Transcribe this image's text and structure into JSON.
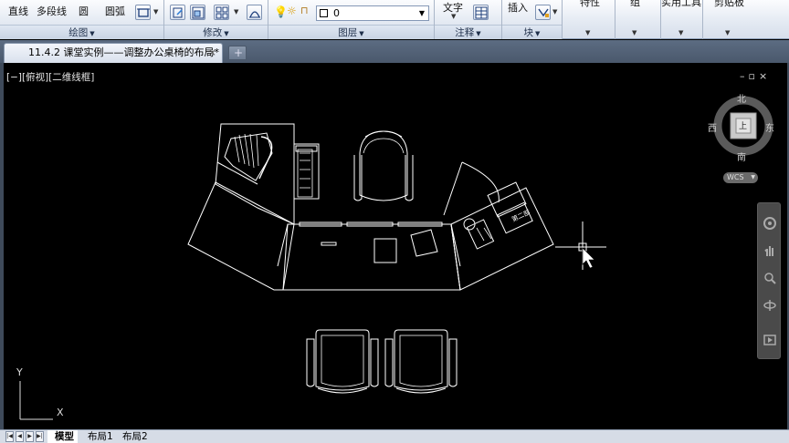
{
  "ribbon": {
    "draw_group": {
      "tools": [
        "直线",
        "多段线",
        "圆",
        "圆弧"
      ],
      "title": "绘图"
    },
    "modify_group": {
      "title": "修改"
    },
    "layers_group": {
      "current_layer": "0",
      "title": "图层"
    },
    "annotation_group": {
      "tools": [
        "文字"
      ],
      "title": "注释"
    },
    "block_group": {
      "tools": [
        "插入"
      ],
      "title": "块"
    },
    "properties_group": {
      "title": "特性"
    },
    "groups_group": {
      "title": "组"
    },
    "utilities_group": {
      "title": "实用工具"
    },
    "clipboard_group": {
      "title": "剪贴板"
    }
  },
  "document_tab": {
    "title": "11.4.2 课堂实例——调整办公桌椅的布局*",
    "close": "×"
  },
  "viewport": {
    "label": "[−][俯视][二维线框]",
    "window_controls": "–▫×"
  },
  "viewcube": {
    "north": "北",
    "south": "南",
    "east": "东",
    "west": "西",
    "wcs": "WCS",
    "face": "上"
  },
  "ucs": {
    "x": "X",
    "y": "Y"
  },
  "phone_label": "第二部",
  "layout_tabs": {
    "model": "模型",
    "layout1": "布局1",
    "layout2": "布局2"
  },
  "colors": {
    "background": "#000000",
    "lines": "#ffffff",
    "ribbon": "#dfe6f1"
  }
}
